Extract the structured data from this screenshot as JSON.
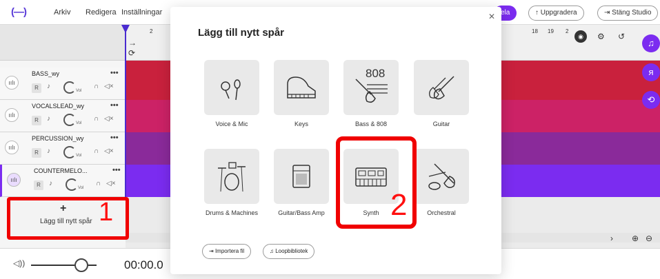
{
  "menubar": {
    "logo": "(—)",
    "items": [
      "Arkiv",
      "Redigera",
      "Inställningar"
    ],
    "share_fragment": "ela",
    "upgrade_label": "↑ Uppgradera",
    "close_studio_label": "⇥ Stäng Studio"
  },
  "ruler": {
    "numbers_left": [
      "2"
    ],
    "numbers_right": [
      "18",
      "19",
      "2"
    ]
  },
  "tracks": [
    {
      "name": "BASS_wy",
      "color": "#c9213d"
    },
    {
      "name": "VOCALSLEAD_wy",
      "color": "#cc2266"
    },
    {
      "name": "PERCUSSION_wy",
      "color": "#8a2a9a"
    },
    {
      "name": "COUNTERMELO...",
      "color": "#7b2cf0"
    }
  ],
  "track_controls": {
    "r": "R",
    "vol": "Vol"
  },
  "add_track": {
    "label": "Lägg till nytt spår",
    "annotation": "1"
  },
  "modal": {
    "title": "Lägg till nytt spår",
    "tiles": [
      {
        "label": "Voice & Mic",
        "icon": "microphone-icon"
      },
      {
        "label": "Keys",
        "icon": "piano-icon"
      },
      {
        "label": "Bass & 808",
        "icon": "bass-808-icon"
      },
      {
        "label": "Guitar",
        "icon": "guitar-icon"
      },
      {
        "label": "Drums & Machines",
        "icon": "drums-icon"
      },
      {
        "label": "Guitar/Bass Amp",
        "icon": "amp-icon"
      },
      {
        "label": "Synth",
        "icon": "synth-icon"
      },
      {
        "label": "Orchestral",
        "icon": "orchestral-icon"
      }
    ],
    "import_label": "Importera fil",
    "loop_label": "Loopbibliotek",
    "annotation": "2",
    "bass_text": "808"
  },
  "bottom": {
    "time": "00:00.0"
  },
  "colors": {
    "accent": "#7b2cf0",
    "annotation": "#f00000"
  }
}
